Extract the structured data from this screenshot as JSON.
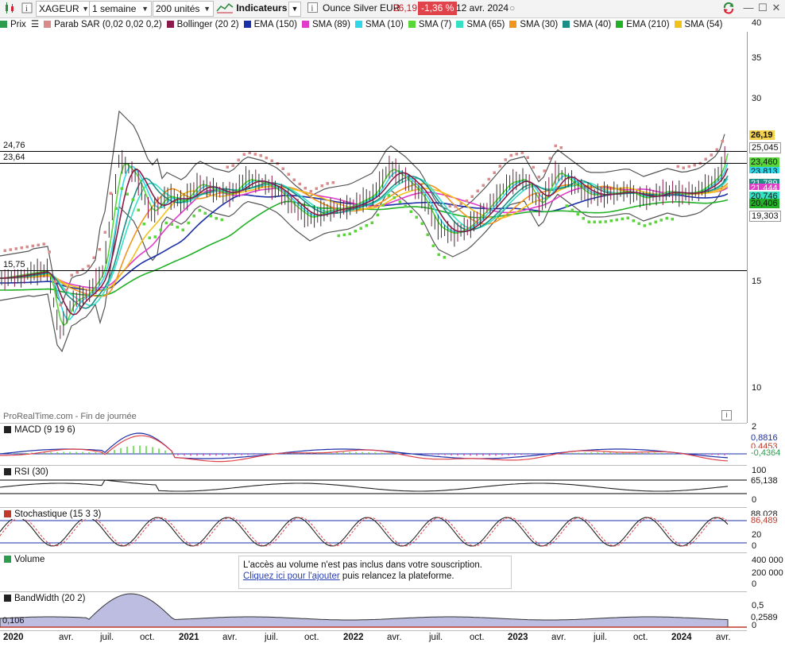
{
  "toolbar": {
    "symbol": "XAGEUR",
    "period": "1 semaine",
    "units": "200 unités",
    "indicators_label": "Indicateurs",
    "instrument_name": "Ounce Silver EUR",
    "last_price": "26,19",
    "change": "-1,36 %",
    "date": "12 avr. 2024"
  },
  "legend": [
    {
      "label": "Prix",
      "color": "#2e9c4f"
    },
    {
      "label": "Parab SAR (0,02 0,02 0,2)",
      "color": "#d98b8b"
    },
    {
      "label": "Bollinger (20 2)",
      "color": "#8b1a4a"
    },
    {
      "label": "EMA (150)",
      "color": "#1b2fa8"
    },
    {
      "label": "SMA (89)",
      "color": "#e13cc9"
    },
    {
      "label": "SMA (10)",
      "color": "#31d6e8"
    },
    {
      "label": "SMA (7)",
      "color": "#58d63a"
    },
    {
      "label": "SMA (65)",
      "color": "#35e0c4"
    },
    {
      "label": "SMA (30)",
      "color": "#f0961e"
    },
    {
      "label": "SMA (40)",
      "color": "#1d8e86"
    },
    {
      "label": "EMA (210)",
      "color": "#22b026"
    },
    {
      "label": "SMA (54)",
      "color": "#f2c21a"
    }
  ],
  "main": {
    "watermark": "ProRealTime.com - Fin de journée",
    "y_ticks": [
      "40",
      "35",
      "30",
      "15",
      "10"
    ],
    "levels": [
      "24,76",
      "23,64",
      "15,75"
    ],
    "right_labels": [
      {
        "text": "26,19",
        "bg": "#f4d24e"
      },
      {
        "text": "25,045",
        "bg": "#ffffff"
      },
      {
        "text": "23,460",
        "bg": "#58d63a"
      },
      {
        "text": "23,813",
        "bg": "#31d6e8"
      },
      {
        "text": "21,789",
        "bg": "#1d8e86"
      },
      {
        "text": "21,444",
        "bg": "#e13cc9"
      },
      {
        "text": "20,746",
        "bg": "#35e0c4"
      },
      {
        "text": "20,406",
        "bg": "#22b026"
      },
      {
        "text": "19,303",
        "bg": "#ffffff"
      }
    ]
  },
  "macd": {
    "title": "MACD (9 19 6)",
    "ticks": [
      "2",
      "0,8816",
      "0,4453",
      "-0,4364"
    ]
  },
  "rsi": {
    "title": "RSI (30)",
    "ticks": [
      "100",
      "65,138",
      "0"
    ]
  },
  "stoch": {
    "title": "Stochastique (15 3 3)",
    "ticks": [
      "88,028",
      "86,489",
      "20",
      "0"
    ]
  },
  "volume": {
    "title": "Volume",
    "ticks": [
      "400 000",
      "200 000",
      "0"
    ],
    "message_line1": "L'accès au volume n'est pas inclus dans votre souscription.",
    "message_link": "Cliquez ici pour l'ajouter",
    "message_rest": " puis relancez la plateforme."
  },
  "bandwidth": {
    "title": "BandWidth (20 2)",
    "ticks": [
      "0,5",
      "0,2589",
      "0"
    ],
    "left_label": "0,106"
  },
  "x_axis": [
    "2020",
    "avr.",
    "juil.",
    "oct.",
    "2021",
    "avr.",
    "juil.",
    "oct.",
    "2022",
    "avr.",
    "juil.",
    "oct.",
    "2023",
    "avr.",
    "juil.",
    "oct.",
    "2024",
    "avr."
  ]
}
